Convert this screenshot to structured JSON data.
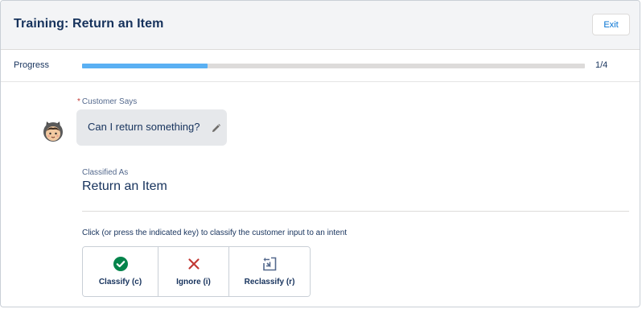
{
  "header": {
    "title": "Training: Return an Item",
    "exit_label": "Exit"
  },
  "progress": {
    "label": "Progress",
    "count_text": "1/4",
    "fraction": 0.25,
    "fill_color": "#5ab0f3"
  },
  "customer": {
    "label": "Customer Says",
    "required_mark": "*",
    "utterance": "Can I return something?",
    "avatar_icon": "astro-avatar-icon",
    "edit_icon": "pencil-icon"
  },
  "classification": {
    "label": "Classified As",
    "value": "Return an Item"
  },
  "instructions": "Click (or press the indicated key) to classify the customer input to an intent",
  "actions": [
    {
      "label": "Classify (c)",
      "icon": "check-circle-icon",
      "color": "#04844b"
    },
    {
      "label": "Ignore (i)",
      "icon": "close-x-icon",
      "color": "#c23934"
    },
    {
      "label": "Reclassify (r)",
      "icon": "reclassify-icon",
      "color": "#54698d"
    }
  ]
}
